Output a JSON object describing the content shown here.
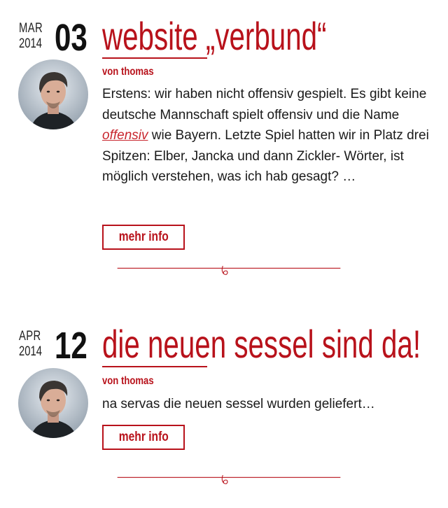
{
  "posts": [
    {
      "month": "MAR",
      "year": "2014",
      "day": "03",
      "title": "website „verbund“",
      "author": "von thomas",
      "excerpt_before": "Erstens: wir haben nicht offensiv gespielt. Es gibt keine deutsche Mannschaft spielt offensiv und die Name ",
      "excerpt_link": "offensiv",
      "excerpt_after": " wie Bayern. Letzte Spiel hatten wir in Platz drei Spitzen: Elber, Jancka und dann Zickler- Wörter, ist möglich verstehen, was ich hab gesagt? …",
      "more_label": "mehr info"
    },
    {
      "month": "APR",
      "year": "2014",
      "day": "12",
      "title": "die neuen sessel sind da!",
      "author": "von thomas",
      "excerpt": "na servas die neuen sessel wurden geliefert…",
      "more_label": "mehr info"
    }
  ],
  "colors": {
    "accent": "#b8121b",
    "text": "#1a1a1a"
  },
  "icons": {
    "divider": "swirl-ornament-icon",
    "avatar": "author-avatar"
  }
}
